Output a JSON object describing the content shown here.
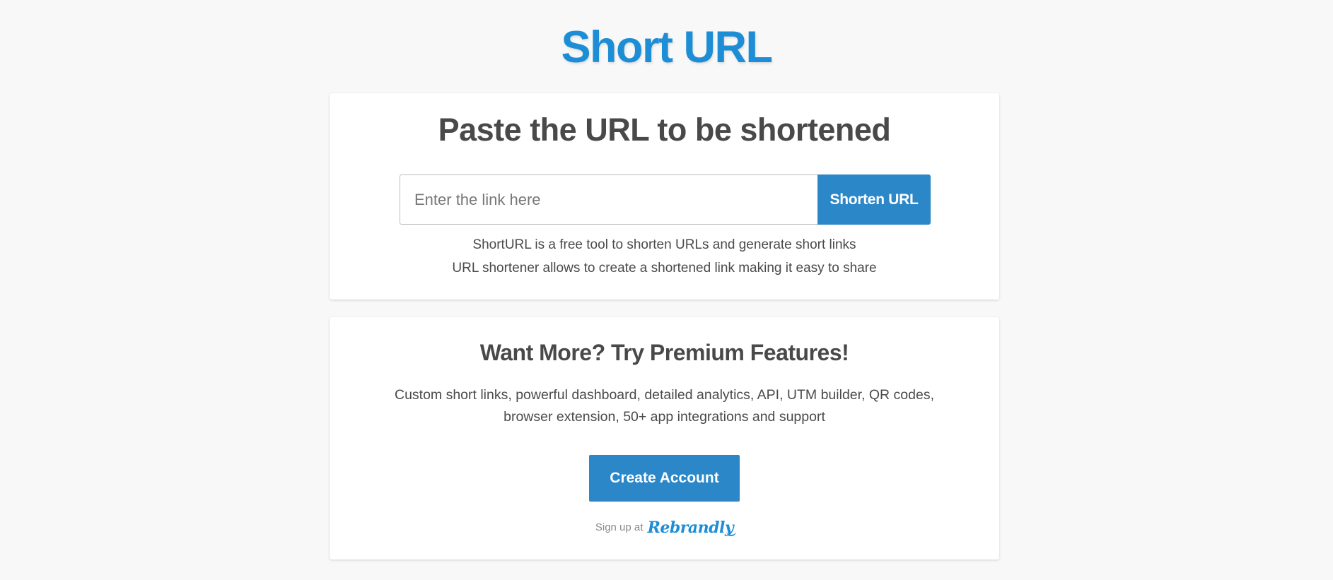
{
  "header": {
    "title": "Short URL"
  },
  "shorten_card": {
    "heading": "Paste the URL to be shortened",
    "input_placeholder": "Enter the link here",
    "input_value": "",
    "button_label": "Shorten URL",
    "info_lines": [
      "ShortURL is a free tool to shorten URLs and generate short links",
      "URL shortener allows to create a shortened link making it easy to share"
    ]
  },
  "premium_card": {
    "heading": "Want More? Try Premium Features!",
    "description_lines": [
      "Custom short links, powerful dashboard, detailed analytics, API, UTM builder, QR codes,",
      "browser extension, 50+ app integrations and support"
    ],
    "button_label": "Create Account",
    "signup_prefix": "Sign up at",
    "signup_brand": "Rebrandly"
  },
  "colors": {
    "brand_blue": "#1d8ed6",
    "button_blue": "#2b87c8",
    "page_background": "#f8f8f8",
    "heading_text": "#494949"
  }
}
